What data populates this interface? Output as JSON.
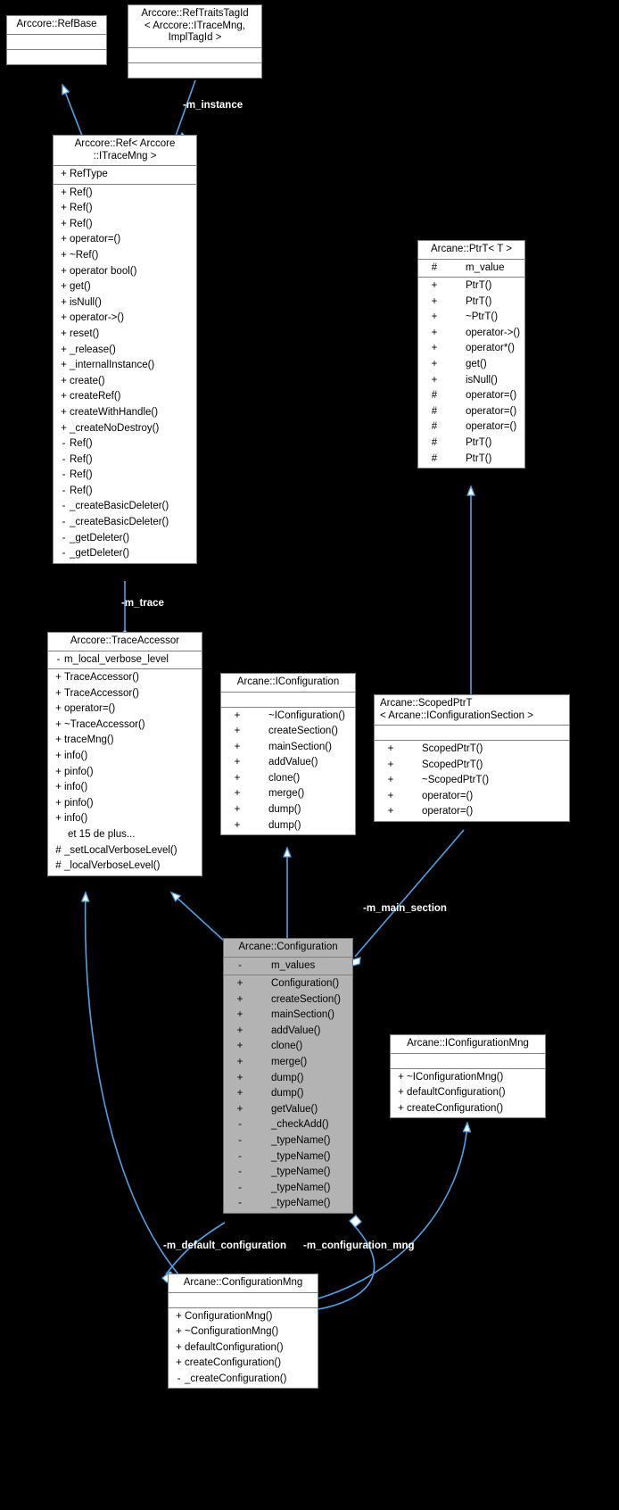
{
  "diagram": {
    "type": "uml-collaboration-diagram",
    "background": "#000000",
    "node_fill": "#ffffff",
    "node_highlight_fill": "#b3b3b3",
    "edge_color": "#4ea3e8",
    "label_color": "#ffffff"
  },
  "nodes": {
    "refbase": {
      "title": "Arccore::RefBase",
      "attributes": [],
      "methods": []
    },
    "reftraits": {
      "title": "Arccore::RefTraitsTagId\n< Arccore::ITraceMng,\nImplTagId >",
      "attributes": [],
      "methods": []
    },
    "ref": {
      "title": "Arccore::Ref< Arccore\n::ITraceMng >",
      "attributes": [
        {
          "vis": "+",
          "name": "RefType"
        }
      ],
      "methods": [
        {
          "vis": "+",
          "name": "Ref()"
        },
        {
          "vis": "+",
          "name": "Ref()"
        },
        {
          "vis": "+",
          "name": "Ref()"
        },
        {
          "vis": "+",
          "name": "operator=()"
        },
        {
          "vis": "+",
          "name": "~Ref()"
        },
        {
          "vis": "+",
          "name": "operator bool()"
        },
        {
          "vis": "+",
          "name": "get()"
        },
        {
          "vis": "+",
          "name": "isNull()"
        },
        {
          "vis": "+",
          "name": "operator->()"
        },
        {
          "vis": "+",
          "name": "reset()"
        },
        {
          "vis": "+",
          "name": "_release()"
        },
        {
          "vis": "+",
          "name": "_internalInstance()"
        },
        {
          "vis": "+",
          "name": "create()"
        },
        {
          "vis": "+",
          "name": "createRef()"
        },
        {
          "vis": "+",
          "name": "createWithHandle()"
        },
        {
          "vis": "+",
          "name": "_createNoDestroy()"
        },
        {
          "vis": "-",
          "name": "Ref()"
        },
        {
          "vis": "-",
          "name": "Ref()"
        },
        {
          "vis": "-",
          "name": "Ref()"
        },
        {
          "vis": "-",
          "name": "Ref()"
        },
        {
          "vis": "-",
          "name": "_createBasicDeleter()"
        },
        {
          "vis": "-",
          "name": "_createBasicDeleter()"
        },
        {
          "vis": "-",
          "name": "_getDeleter()"
        },
        {
          "vis": "-",
          "name": "_getDeleter()"
        }
      ]
    },
    "ptrt": {
      "title": "Arcane::PtrT< T >",
      "attributes": [
        {
          "vis": "#",
          "name": "m_value"
        }
      ],
      "methods": [
        {
          "vis": "+",
          "name": "PtrT()"
        },
        {
          "vis": "+",
          "name": "PtrT()"
        },
        {
          "vis": "+",
          "name": "~PtrT()"
        },
        {
          "vis": "+",
          "name": "operator->()"
        },
        {
          "vis": "+",
          "name": "operator*()"
        },
        {
          "vis": "+",
          "name": "get()"
        },
        {
          "vis": "+",
          "name": "isNull()"
        },
        {
          "vis": "#",
          "name": "operator=()"
        },
        {
          "vis": "#",
          "name": "operator=()"
        },
        {
          "vis": "#",
          "name": "operator=()"
        },
        {
          "vis": "#",
          "name": "PtrT()"
        },
        {
          "vis": "#",
          "name": "PtrT()"
        }
      ]
    },
    "traceaccessor": {
      "title": "Arccore::TraceAccessor",
      "attributes": [
        {
          "vis": "-",
          "name": "m_local_verbose_level"
        }
      ],
      "methods": [
        {
          "vis": "+",
          "name": "TraceAccessor()"
        },
        {
          "vis": "+",
          "name": "TraceAccessor()"
        },
        {
          "vis": "+",
          "name": "operator=()"
        },
        {
          "vis": "+",
          "name": "~TraceAccessor()"
        },
        {
          "vis": "+",
          "name": "traceMng()"
        },
        {
          "vis": "+",
          "name": "info()"
        },
        {
          "vis": "+",
          "name": "pinfo()"
        },
        {
          "vis": "+",
          "name": "info()"
        },
        {
          "vis": "+",
          "name": "pinfo()"
        },
        {
          "vis": "+",
          "name": "info()"
        },
        {
          "vis": "",
          "name": "et 15 de plus..."
        },
        {
          "vis": "#",
          "name": "_setLocalVerboseLevel()"
        },
        {
          "vis": "#",
          "name": "_localVerboseLevel()"
        }
      ]
    },
    "iconfiguration": {
      "title": "Arcane::IConfiguration",
      "attributes": [],
      "methods": [
        {
          "vis": "+",
          "name": "~IConfiguration()"
        },
        {
          "vis": "+",
          "name": "createSection()"
        },
        {
          "vis": "+",
          "name": "mainSection()"
        },
        {
          "vis": "+",
          "name": "addValue()"
        },
        {
          "vis": "+",
          "name": "clone()"
        },
        {
          "vis": "+",
          "name": "merge()"
        },
        {
          "vis": "+",
          "name": "dump()"
        },
        {
          "vis": "+",
          "name": "dump()"
        }
      ]
    },
    "scopedptrt": {
      "title": "Arcane::ScopedPtrT\n< Arcane::IConfigurationSection >",
      "attributes": [],
      "methods": [
        {
          "vis": "+",
          "name": "ScopedPtrT()"
        },
        {
          "vis": "+",
          "name": "ScopedPtrT()"
        },
        {
          "vis": "+",
          "name": "~ScopedPtrT()"
        },
        {
          "vis": "+",
          "name": "operator=()"
        },
        {
          "vis": "+",
          "name": "operator=()"
        }
      ]
    },
    "configuration": {
      "title": "Arcane::Configuration",
      "highlight": true,
      "attributes": [
        {
          "vis": "-",
          "name": "m_values"
        }
      ],
      "methods": [
        {
          "vis": "+",
          "name": "Configuration()"
        },
        {
          "vis": "+",
          "name": "createSection()"
        },
        {
          "vis": "+",
          "name": "mainSection()"
        },
        {
          "vis": "+",
          "name": "addValue()"
        },
        {
          "vis": "+",
          "name": "clone()"
        },
        {
          "vis": "+",
          "name": "merge()"
        },
        {
          "vis": "+",
          "name": "dump()"
        },
        {
          "vis": "+",
          "name": "dump()"
        },
        {
          "vis": "+",
          "name": "getValue()"
        },
        {
          "vis": "-",
          "name": "_checkAdd()"
        },
        {
          "vis": "-",
          "name": "_typeName()"
        },
        {
          "vis": "-",
          "name": "_typeName()"
        },
        {
          "vis": "-",
          "name": "_typeName()"
        },
        {
          "vis": "-",
          "name": "_typeName()"
        },
        {
          "vis": "-",
          "name": "_typeName()"
        }
      ]
    },
    "iconfigurationmng": {
      "title": "Arcane::IConfigurationMng",
      "attributes": [],
      "methods": [
        {
          "vis": "+",
          "name": "~IConfigurationMng()"
        },
        {
          "vis": "+",
          "name": "defaultConfiguration()"
        },
        {
          "vis": "+",
          "name": "createConfiguration()"
        }
      ]
    },
    "configurationmng": {
      "title": "Arcane::ConfigurationMng",
      "attributes": [],
      "methods": [
        {
          "vis": "+",
          "name": "ConfigurationMng()"
        },
        {
          "vis": "+",
          "name": "~ConfigurationMng()"
        },
        {
          "vis": "+",
          "name": "defaultConfiguration()"
        },
        {
          "vis": "+",
          "name": "createConfiguration()"
        },
        {
          "vis": "-",
          "name": "_createConfiguration()"
        }
      ]
    }
  },
  "edge_labels": {
    "m_instance": "-m_instance",
    "m_trace": "-m_trace",
    "m_main_section": "-m_main_section",
    "m_default_configuration": "-m_default_configuration",
    "m_configuration_mng": "-m_configuration_mng"
  }
}
